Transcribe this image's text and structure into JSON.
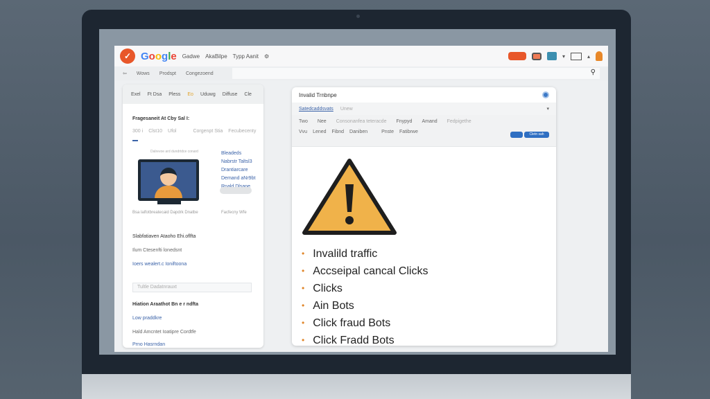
{
  "topbar": {
    "logo_letters": [
      "G",
      "o",
      "o",
      "g",
      "l",
      "e"
    ],
    "menu": [
      "Gadwe",
      "AkaBilpe",
      "Typp Aanit"
    ]
  },
  "navbar": {
    "items": [
      "Wows",
      "Prodspt",
      "Congezoend"
    ],
    "search_placeholder": ""
  },
  "left_panel": {
    "tabs": [
      "Exel",
      "Ft Dsa",
      "Pless",
      "Eo",
      "Uduwg",
      "Diffuse",
      "Cle"
    ],
    "active_tab_index": 3,
    "heading": "Fragesaneit At Cby Sal I:",
    "subtabs": [
      "300 i",
      "Clst10",
      "Ufol",
      "Corgenpt Stia",
      "Fecubecenty"
    ],
    "caption_top": "Dalrevoe ard dundrtdce conard",
    "side_links": [
      "Bleadeds",
      "Nabrstr Taltsl3",
      "Drantiarcare",
      "Demand aNr9bt",
      "Rnald Dlsane"
    ],
    "caption_bottom": "Bsa lalfotbreatecaid Dapdrk Dnatbe",
    "caption_bottom_right": "Facfecny Wfe",
    "lines": [
      "Slabfatiaven Ataoho Ehi.oflfta",
      "Ilum Ctesenfti lonedsnt",
      "Ioers wealert.c Ioniftoona"
    ],
    "input_placeholder": "Tultle Dadatnrauxt",
    "heading2": "Hiation Araathot Bn e r ndfta",
    "lines2": [
      "Low praddkre",
      "Hald Amcntet Ioatipre Cordtfe",
      "Prno Hasrndan"
    ]
  },
  "card": {
    "title": "Invalid Trnbnpe",
    "sub_link": "Satedcaddsvats",
    "sub_text": "Unew",
    "filter_row1": [
      "Two",
      "Nee",
      "Consonanfea teteracde",
      "Fnypyd",
      "Amand",
      "Fedpigethe"
    ],
    "filter_row2": [
      "Vvu",
      "Lened",
      "Fibnd",
      "Daniben",
      "Pnste",
      "Fatibrwe"
    ],
    "button_primary": "Cletn sah",
    "bullets": [
      "Invalild traffic",
      "Accseipal cancal Clicks",
      "Clicks",
      "Ain Bots",
      "Click fraud Bots",
      "Click Fradd Bots"
    ]
  },
  "colors": {
    "accent": "#e8572a",
    "warning": "#f0b24a",
    "bullet": "#e0862a",
    "link": "#3a62a8",
    "button": "#2f6fc2"
  }
}
